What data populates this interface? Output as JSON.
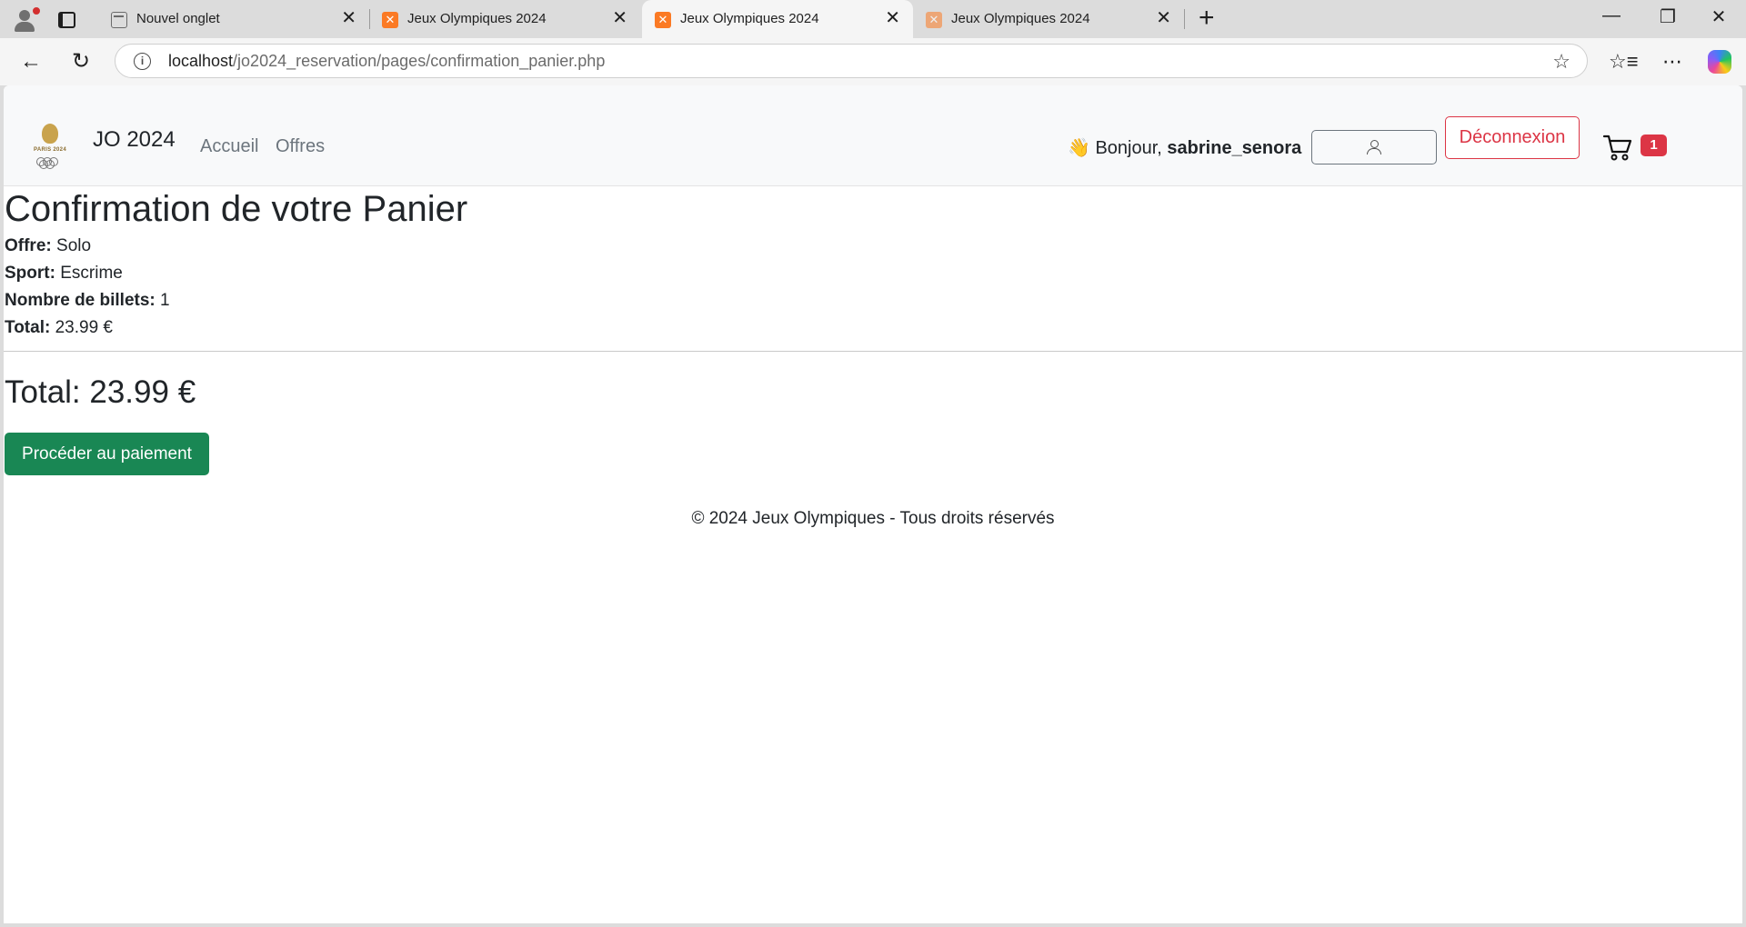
{
  "browser": {
    "tabs": [
      {
        "title": "Nouvel onglet",
        "active": false
      },
      {
        "title": "Jeux Olympiques 2024",
        "active": false
      },
      {
        "title": "Jeux Olympiques 2024",
        "active": true
      },
      {
        "title": "Jeux Olympiques 2024",
        "active": false
      }
    ],
    "url_host": "localhost",
    "url_path": "/jo2024_reservation/pages/confirmation_panier.php"
  },
  "navbar": {
    "logo_text": "PARIS 2024",
    "brand": "JO 2024",
    "links": [
      "Accueil",
      "Offres"
    ],
    "greeting_prefix": "👋 Bonjour,",
    "username": "sabrine_senora",
    "logout_label": "Déconnexion",
    "cart_count": "1"
  },
  "page": {
    "title": "Confirmation de votre Panier",
    "details": [
      {
        "label": "Offre:",
        "value": "Solo"
      },
      {
        "label": "Sport:",
        "value": "Escrime"
      },
      {
        "label": "Nombre de billets:",
        "value": "1"
      },
      {
        "label": "Total:",
        "value": "23.99 €"
      }
    ],
    "grand_total": "Total: 23.99 €",
    "pay_button": "Procéder au paiement",
    "footer": "© 2024 Jeux Olympiques - Tous droits réservés"
  },
  "colors": {
    "danger": "#dc3545",
    "success": "#198754",
    "xampp_orange": "#fb7a24"
  }
}
